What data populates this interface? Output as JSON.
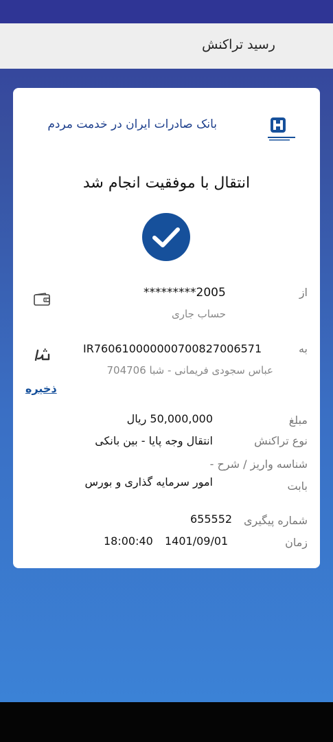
{
  "header": {
    "title": "رسید تراکنش"
  },
  "bank": {
    "name": "بانک صادرات ایران در خدمت مردم",
    "logo_icon": "bank-saderat-logo"
  },
  "status": {
    "title": "انتقال با موفقیت انجام شد"
  },
  "from": {
    "label": "از",
    "account": "*********2005",
    "account_type": "حساب جاری",
    "icon": "wallet-icon"
  },
  "to": {
    "label": "به",
    "iban": "IR760610000000700827006571",
    "holder": "عباس سجودی فریمانی - شبا 704706",
    "icon": "shaba-icon",
    "save_label": "ذخیره"
  },
  "details": {
    "amount_label": "مبلغ",
    "amount_value": "50,000,000 ریال",
    "type_label": "نوع تراکنش",
    "type_value": "انتقال وجه پایا - بین بانکی",
    "deposit_id_label": "شناسه واریز / شرح -",
    "purpose_label": "بابت",
    "purpose_value": "امور سرمایه گذاری و بورس",
    "tracking_label": "شماره پیگیری",
    "tracking_value": "655552",
    "time_label": "زمان",
    "date_value": "1401/09/01",
    "time_value": "18:00:40"
  },
  "colors": {
    "brand": "#16509b",
    "bank_text": "#1d3f8c"
  }
}
